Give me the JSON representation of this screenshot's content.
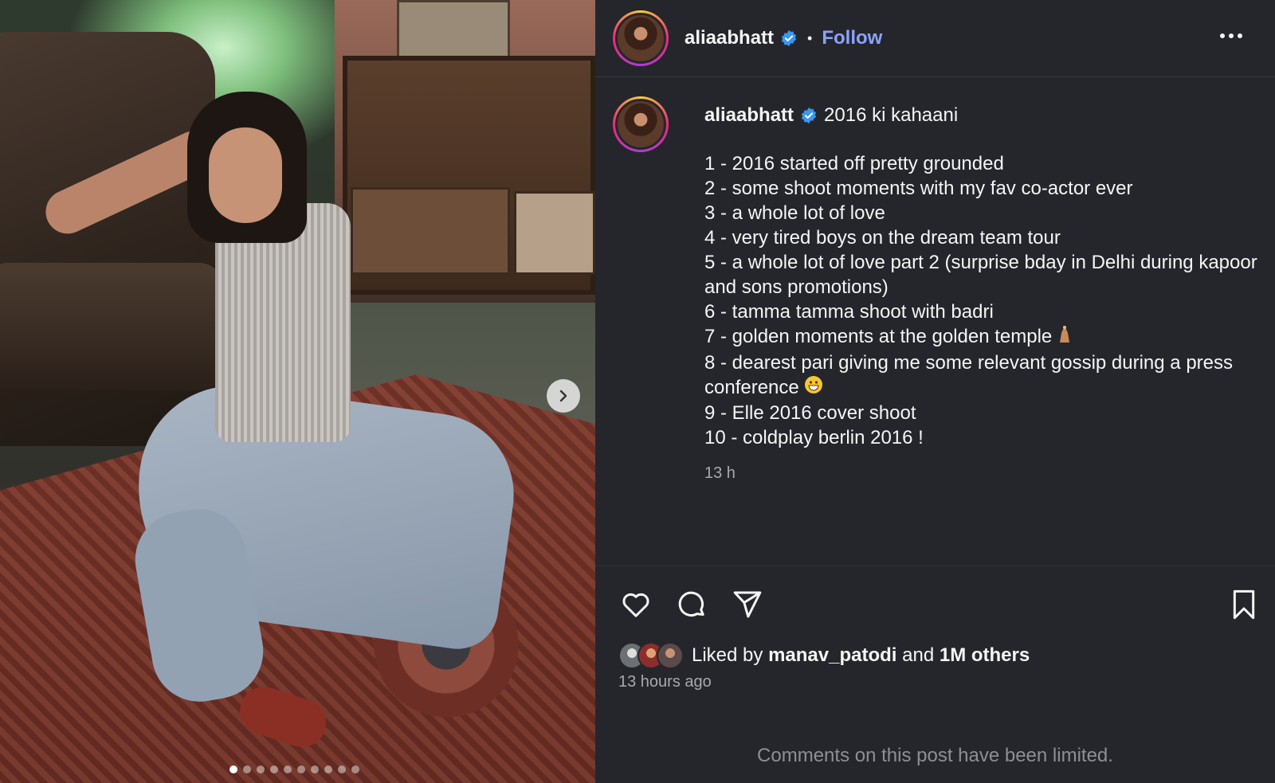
{
  "post": {
    "username": "aliaabhatt",
    "follow_label": "Follow",
    "separator": "•",
    "carousel": {
      "total_slides": 10,
      "active_index": 0
    }
  },
  "caption": {
    "username": "aliaabhatt",
    "title": "2016 ki kahaani",
    "lines": [
      "1 - 2016 started off pretty grounded",
      "2 - some shoot moments with my fav co-actor ever",
      "3 - a whole lot of love",
      "4 - very tired boys on the dream team tour",
      "5 - a whole lot of love part 2 (surprise bday in Delhi during kapoor and sons promotions)",
      "6 - tamma tamma shoot with badri",
      "7 - golden moments at the golden temple",
      "8 - dearest pari giving me some relevant gossip during a press conference",
      "9 - Elle 2016 cover shoot",
      "10 - coldplay berlin 2016 !"
    ],
    "age": "13 h"
  },
  "likes": {
    "prefix": "Liked by",
    "user": "manav_patodi",
    "and": "and",
    "others": "1M others"
  },
  "time_ago": "13 hours ago",
  "comments_limited": "Comments on this post have been limited.",
  "colors": {
    "background": "#25262b",
    "follow": "#8ba2ff",
    "verified": "#3897f0",
    "muted": "#a8a8ad"
  },
  "icons": [
    "heart-icon",
    "comment-icon",
    "share-icon",
    "bookmark-icon",
    "more-icon",
    "chevron-right-icon",
    "verified-badge-icon"
  ]
}
